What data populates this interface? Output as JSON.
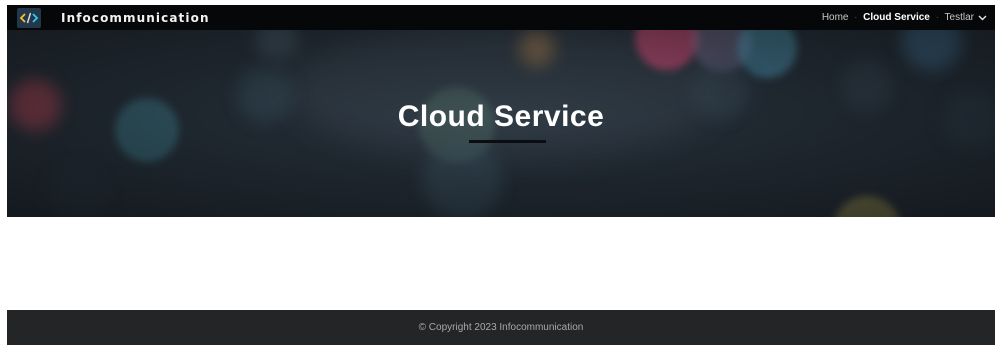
{
  "header": {
    "brand": "Infocommunication",
    "logo_icon": "code-tag-icon",
    "nav": {
      "home": "Home",
      "cloud_service": "Cloud Service",
      "testlar": "Testlar",
      "separator": "·"
    }
  },
  "hero": {
    "title": "Cloud Service"
  },
  "footer": {
    "copyright": "© Copyright 2023 Infocommunication"
  },
  "colors": {
    "topbar": "#050709",
    "hero_dark": "#1b232b",
    "footer": "#232526",
    "text_light": "#ffffff"
  }
}
